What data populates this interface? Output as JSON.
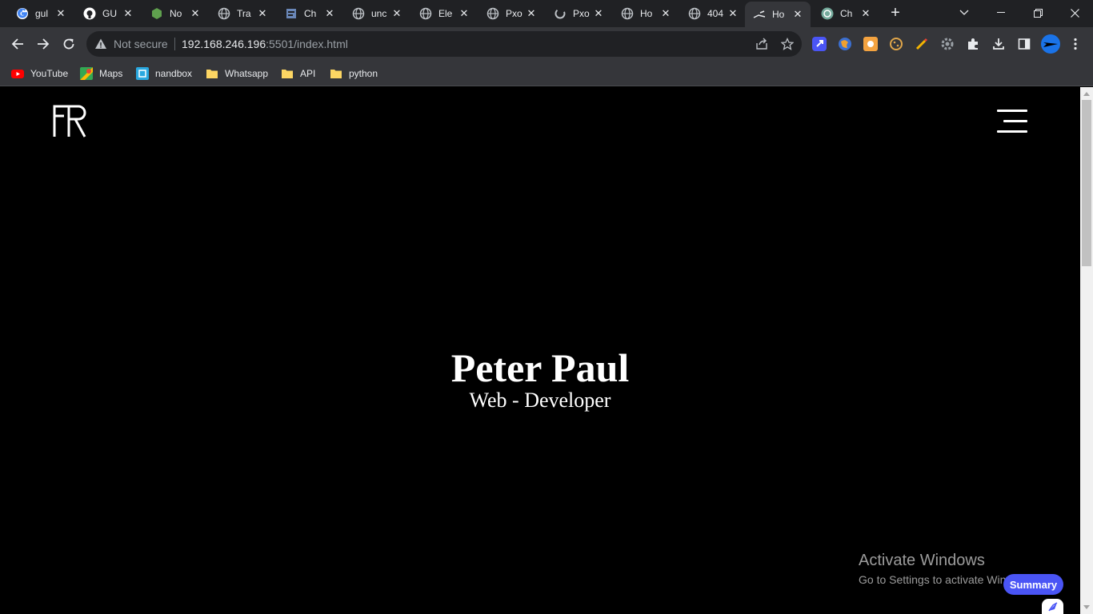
{
  "browser": {
    "tabs": [
      {
        "title": "gul",
        "icon": "google-icon"
      },
      {
        "title": "GU",
        "icon": "github-icon"
      },
      {
        "title": "No",
        "icon": "nodejs-icon"
      },
      {
        "title": "Tra",
        "icon": "globe-icon"
      },
      {
        "title": "Ch",
        "icon": "page-icon"
      },
      {
        "title": "unc",
        "icon": "globe-icon"
      },
      {
        "title": "Ele",
        "icon": "globe-icon"
      },
      {
        "title": "Pxo",
        "icon": "globe-icon"
      },
      {
        "title": "Pxo",
        "icon": "loading-icon"
      },
      {
        "title": "Ho",
        "icon": "globe-icon"
      },
      {
        "title": "404",
        "icon": "globe-icon"
      },
      {
        "title": "Ho",
        "icon": "site-icon",
        "active": true
      },
      {
        "title": "Ch",
        "icon": "chatgpt-icon"
      }
    ],
    "security_label": "Not secure",
    "url_host": "192.168.246.196",
    "url_rest": ":5501/index.html",
    "bookmarks": [
      {
        "label": "YouTube",
        "icon": "youtube-icon"
      },
      {
        "label": "Maps",
        "icon": "maps-icon"
      },
      {
        "label": "nandbox",
        "icon": "nandbox-icon"
      },
      {
        "label": "Whatsapp",
        "icon": "folder-icon"
      },
      {
        "label": "API",
        "icon": "folder-icon"
      },
      {
        "label": "python",
        "icon": "folder-icon"
      }
    ]
  },
  "page": {
    "name": "Peter Paul",
    "role": "Web - Developer"
  },
  "overlay": {
    "activate_title": "Activate Windows",
    "activate_subtitle": "Go to Settings to activate Windows.",
    "summary_label": "Summary"
  },
  "colors": {
    "tabstrip_bg": "#202124",
    "toolbar_bg": "#35363a",
    "page_bg": "#000000",
    "summary_accent": "#4a55f5"
  }
}
